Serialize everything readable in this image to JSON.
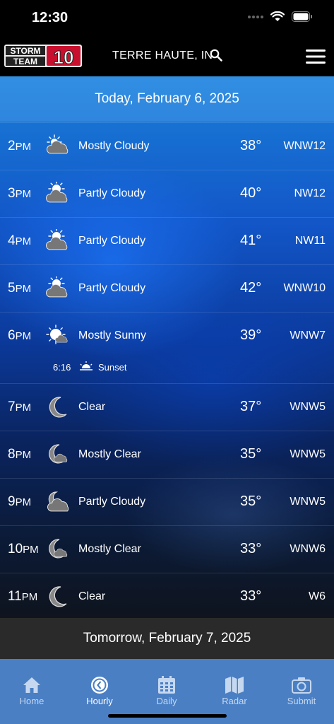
{
  "status": {
    "time": "12:30"
  },
  "header": {
    "logo_top": "STORM",
    "logo_bottom": "TEAM",
    "logo_number": "10",
    "location": "TERRE HAUTE, IN"
  },
  "today_label": "Today, February 6, 2025",
  "tomorrow_label": "Tomorrow, February 7, 2025",
  "hours": [
    {
      "hour": "2",
      "ampm": "PM",
      "icon": "mostly-cloudy-icon",
      "condition": "Mostly Cloudy",
      "temp": "38°",
      "wind": "WNW12"
    },
    {
      "hour": "3",
      "ampm": "PM",
      "icon": "partly-cloudy-icon",
      "condition": "Partly Cloudy",
      "temp": "40°",
      "wind": "NW12"
    },
    {
      "hour": "4",
      "ampm": "PM",
      "icon": "partly-cloudy-icon",
      "condition": "Partly Cloudy",
      "temp": "41°",
      "wind": "NW11"
    },
    {
      "hour": "5",
      "ampm": "PM",
      "icon": "partly-cloudy-icon",
      "condition": "Partly Cloudy",
      "temp": "42°",
      "wind": "WNW10"
    },
    {
      "hour": "6",
      "ampm": "PM",
      "icon": "mostly-sunny-icon",
      "condition": "Mostly Sunny",
      "temp": "39°",
      "wind": "WNW7",
      "sunset_time": "6:16",
      "sunset_label": "Sunset"
    },
    {
      "hour": "7",
      "ampm": "PM",
      "icon": "moon-icon",
      "condition": "Clear",
      "temp": "37°",
      "wind": "WNW5"
    },
    {
      "hour": "8",
      "ampm": "PM",
      "icon": "moon-cloud-icon",
      "condition": "Mostly Clear",
      "temp": "35°",
      "wind": "WNW5"
    },
    {
      "hour": "9",
      "ampm": "PM",
      "icon": "moon-partly-cloudy-icon",
      "condition": "Partly Cloudy",
      "temp": "35°",
      "wind": "WNW5"
    },
    {
      "hour": "10",
      "ampm": "PM",
      "icon": "moon-cloud-icon",
      "condition": "Mostly Clear",
      "temp": "33°",
      "wind": "WNW6"
    },
    {
      "hour": "11",
      "ampm": "PM",
      "icon": "moon-icon",
      "condition": "Clear",
      "temp": "33°",
      "wind": "W6"
    }
  ],
  "tabs": [
    {
      "label": "Home",
      "icon": "home-icon"
    },
    {
      "label": "Hourly",
      "icon": "clock-icon"
    },
    {
      "label": "Daily",
      "icon": "calendar-icon"
    },
    {
      "label": "Radar",
      "icon": "map-icon"
    },
    {
      "label": "Submit",
      "icon": "camera-icon"
    }
  ],
  "colors": {
    "tabbar": "#4a7fc4",
    "tab_active": "#ffffff",
    "tab_inactive": "#c5d8f0",
    "logo_red": "#c8102e"
  }
}
